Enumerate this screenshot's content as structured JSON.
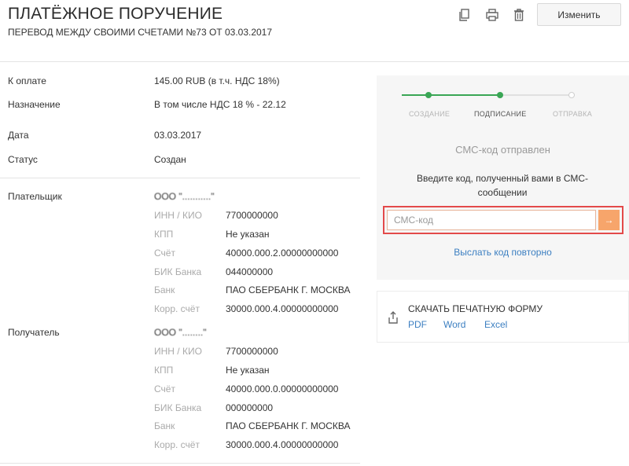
{
  "header": {
    "title": "ПЛАТЁЖНОЕ ПОРУЧЕНИЕ",
    "subtitle": "ПЕРЕВОД МЕЖДУ СВОИМИ СЧЕТАМИ №73 ОТ 03.03.2017",
    "edit_label": "Изменить",
    "icons": [
      "copy-icon",
      "print-icon",
      "trash-icon"
    ]
  },
  "details": {
    "amount_label": "К оплате",
    "amount_value": "145.00 RUB (в т.ч. НДС 18%)",
    "purpose_label": "Назначение",
    "purpose_value": "В том числе НДС 18 % - 22.12",
    "date_label": "Дата",
    "date_value": "03.03.2017",
    "status_label": "Статус",
    "status_value": "Создан"
  },
  "payer": {
    "label": "Плательщик",
    "name": "ООО \"...........\"",
    "fields": [
      {
        "label": "ИНН / КИО",
        "value": "7700000000"
      },
      {
        "label": "КПП",
        "value": "Не указан"
      },
      {
        "label": "Счёт",
        "value": "40000.000.2.00000000000"
      },
      {
        "label": "БИК Банка",
        "value": "044000000"
      },
      {
        "label": "Банк",
        "value": "ПАО СБЕРБАНК Г. МОСКВА"
      },
      {
        "label": "Корр. счёт",
        "value": "30000.000.4.00000000000"
      }
    ]
  },
  "recipient": {
    "label": "Получатель",
    "name": "ООО \"........\"",
    "fields": [
      {
        "label": "ИНН / КИО",
        "value": "7700000000"
      },
      {
        "label": "КПП",
        "value": "Не указан"
      },
      {
        "label": "Счёт",
        "value": "40000.000.0.00000000000"
      },
      {
        "label": "БИК Банка",
        "value": "000000000"
      },
      {
        "label": "Банк",
        "value": "ПАО СБЕРБАНК Г. МОСКВА"
      },
      {
        "label": "Корр. счёт",
        "value": "30000.000.4.00000000000"
      }
    ]
  },
  "sms": {
    "steps": [
      "СОЗДАНИЕ",
      "ПОДПИСАНИЕ",
      "ОТПРАВКА"
    ],
    "active_step": "ПОДПИСАНИЕ",
    "sent_text": "СМС-код отправлен",
    "hint_text": "Введите код, полученный вами в СМС-сообщении",
    "input_placeholder": "СМС-код",
    "submit_glyph": "→",
    "resend_label": "Выслать код повторно"
  },
  "download": {
    "title": "СКАЧАТЬ ПЕЧАТНУЮ ФОРМУ",
    "formats": [
      "PDF",
      "Word",
      "Excel"
    ]
  },
  "colors": {
    "accent_green": "#3aa655",
    "link_blue": "#3c7fc1",
    "highlight_red": "#e34a4a",
    "submit_orange": "#f7a56b"
  }
}
